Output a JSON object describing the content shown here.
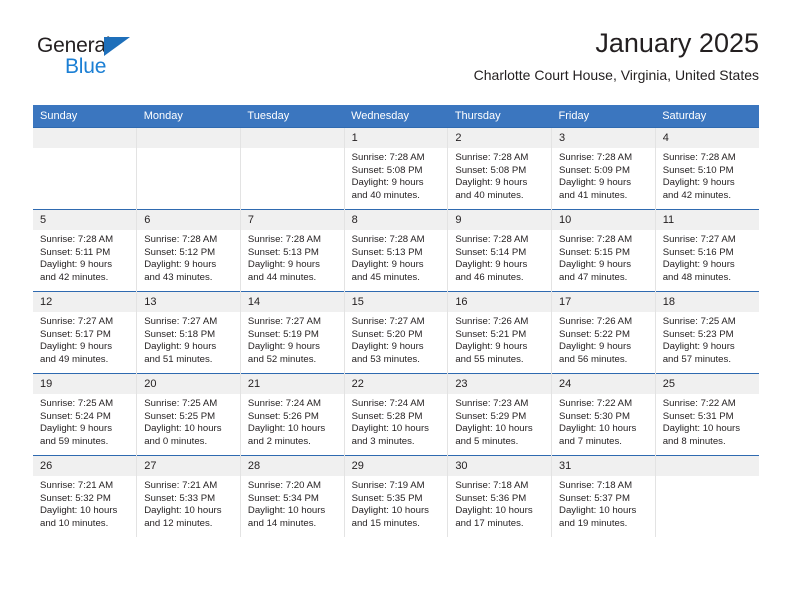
{
  "logo": {
    "word_primary": "General",
    "word_secondary": "Blue",
    "triangle_color": "#1e6fba",
    "secondary_color": "#1b7fd4"
  },
  "header": {
    "title": "January 2025",
    "subtitle": "Charlotte Court House, Virginia, United States"
  },
  "theme": {
    "header_blue": "#3b76bf",
    "row_rule_blue": "#2f6ab0",
    "daynum_band": "#f0f0f0"
  },
  "day_headers": [
    "Sunday",
    "Monday",
    "Tuesday",
    "Wednesday",
    "Thursday",
    "Friday",
    "Saturday"
  ],
  "weeks": [
    [
      {
        "day": "",
        "empty": true,
        "sunrise": "",
        "sunset": "",
        "daylight1": "",
        "daylight2": ""
      },
      {
        "day": "",
        "empty": true,
        "sunrise": "",
        "sunset": "",
        "daylight1": "",
        "daylight2": ""
      },
      {
        "day": "",
        "empty": true,
        "sunrise": "",
        "sunset": "",
        "daylight1": "",
        "daylight2": ""
      },
      {
        "day": "1",
        "sunrise": "Sunrise: 7:28 AM",
        "sunset": "Sunset: 5:08 PM",
        "daylight1": "Daylight: 9 hours",
        "daylight2": "and 40 minutes."
      },
      {
        "day": "2",
        "sunrise": "Sunrise: 7:28 AM",
        "sunset": "Sunset: 5:08 PM",
        "daylight1": "Daylight: 9 hours",
        "daylight2": "and 40 minutes."
      },
      {
        "day": "3",
        "sunrise": "Sunrise: 7:28 AM",
        "sunset": "Sunset: 5:09 PM",
        "daylight1": "Daylight: 9 hours",
        "daylight2": "and 41 minutes."
      },
      {
        "day": "4",
        "sunrise": "Sunrise: 7:28 AM",
        "sunset": "Sunset: 5:10 PM",
        "daylight1": "Daylight: 9 hours",
        "daylight2": "and 42 minutes."
      }
    ],
    [
      {
        "day": "5",
        "sunrise": "Sunrise: 7:28 AM",
        "sunset": "Sunset: 5:11 PM",
        "daylight1": "Daylight: 9 hours",
        "daylight2": "and 42 minutes."
      },
      {
        "day": "6",
        "sunrise": "Sunrise: 7:28 AM",
        "sunset": "Sunset: 5:12 PM",
        "daylight1": "Daylight: 9 hours",
        "daylight2": "and 43 minutes."
      },
      {
        "day": "7",
        "sunrise": "Sunrise: 7:28 AM",
        "sunset": "Sunset: 5:13 PM",
        "daylight1": "Daylight: 9 hours",
        "daylight2": "and 44 minutes."
      },
      {
        "day": "8",
        "sunrise": "Sunrise: 7:28 AM",
        "sunset": "Sunset: 5:13 PM",
        "daylight1": "Daylight: 9 hours",
        "daylight2": "and 45 minutes."
      },
      {
        "day": "9",
        "sunrise": "Sunrise: 7:28 AM",
        "sunset": "Sunset: 5:14 PM",
        "daylight1": "Daylight: 9 hours",
        "daylight2": "and 46 minutes."
      },
      {
        "day": "10",
        "sunrise": "Sunrise: 7:28 AM",
        "sunset": "Sunset: 5:15 PM",
        "daylight1": "Daylight: 9 hours",
        "daylight2": "and 47 minutes."
      },
      {
        "day": "11",
        "sunrise": "Sunrise: 7:27 AM",
        "sunset": "Sunset: 5:16 PM",
        "daylight1": "Daylight: 9 hours",
        "daylight2": "and 48 minutes."
      }
    ],
    [
      {
        "day": "12",
        "sunrise": "Sunrise: 7:27 AM",
        "sunset": "Sunset: 5:17 PM",
        "daylight1": "Daylight: 9 hours",
        "daylight2": "and 49 minutes."
      },
      {
        "day": "13",
        "sunrise": "Sunrise: 7:27 AM",
        "sunset": "Sunset: 5:18 PM",
        "daylight1": "Daylight: 9 hours",
        "daylight2": "and 51 minutes."
      },
      {
        "day": "14",
        "sunrise": "Sunrise: 7:27 AM",
        "sunset": "Sunset: 5:19 PM",
        "daylight1": "Daylight: 9 hours",
        "daylight2": "and 52 minutes."
      },
      {
        "day": "15",
        "sunrise": "Sunrise: 7:27 AM",
        "sunset": "Sunset: 5:20 PM",
        "daylight1": "Daylight: 9 hours",
        "daylight2": "and 53 minutes."
      },
      {
        "day": "16",
        "sunrise": "Sunrise: 7:26 AM",
        "sunset": "Sunset: 5:21 PM",
        "daylight1": "Daylight: 9 hours",
        "daylight2": "and 55 minutes."
      },
      {
        "day": "17",
        "sunrise": "Sunrise: 7:26 AM",
        "sunset": "Sunset: 5:22 PM",
        "daylight1": "Daylight: 9 hours",
        "daylight2": "and 56 minutes."
      },
      {
        "day": "18",
        "sunrise": "Sunrise: 7:25 AM",
        "sunset": "Sunset: 5:23 PM",
        "daylight1": "Daylight: 9 hours",
        "daylight2": "and 57 minutes."
      }
    ],
    [
      {
        "day": "19",
        "sunrise": "Sunrise: 7:25 AM",
        "sunset": "Sunset: 5:24 PM",
        "daylight1": "Daylight: 9 hours",
        "daylight2": "and 59 minutes."
      },
      {
        "day": "20",
        "sunrise": "Sunrise: 7:25 AM",
        "sunset": "Sunset: 5:25 PM",
        "daylight1": "Daylight: 10 hours",
        "daylight2": "and 0 minutes."
      },
      {
        "day": "21",
        "sunrise": "Sunrise: 7:24 AM",
        "sunset": "Sunset: 5:26 PM",
        "daylight1": "Daylight: 10 hours",
        "daylight2": "and 2 minutes."
      },
      {
        "day": "22",
        "sunrise": "Sunrise: 7:24 AM",
        "sunset": "Sunset: 5:28 PM",
        "daylight1": "Daylight: 10 hours",
        "daylight2": "and 3 minutes."
      },
      {
        "day": "23",
        "sunrise": "Sunrise: 7:23 AM",
        "sunset": "Sunset: 5:29 PM",
        "daylight1": "Daylight: 10 hours",
        "daylight2": "and 5 minutes."
      },
      {
        "day": "24",
        "sunrise": "Sunrise: 7:22 AM",
        "sunset": "Sunset: 5:30 PM",
        "daylight1": "Daylight: 10 hours",
        "daylight2": "and 7 minutes."
      },
      {
        "day": "25",
        "sunrise": "Sunrise: 7:22 AM",
        "sunset": "Sunset: 5:31 PM",
        "daylight1": "Daylight: 10 hours",
        "daylight2": "and 8 minutes."
      }
    ],
    [
      {
        "day": "26",
        "sunrise": "Sunrise: 7:21 AM",
        "sunset": "Sunset: 5:32 PM",
        "daylight1": "Daylight: 10 hours",
        "daylight2": "and 10 minutes."
      },
      {
        "day": "27",
        "sunrise": "Sunrise: 7:21 AM",
        "sunset": "Sunset: 5:33 PM",
        "daylight1": "Daylight: 10 hours",
        "daylight2": "and 12 minutes."
      },
      {
        "day": "28",
        "sunrise": "Sunrise: 7:20 AM",
        "sunset": "Sunset: 5:34 PM",
        "daylight1": "Daylight: 10 hours",
        "daylight2": "and 14 minutes."
      },
      {
        "day": "29",
        "sunrise": "Sunrise: 7:19 AM",
        "sunset": "Sunset: 5:35 PM",
        "daylight1": "Daylight: 10 hours",
        "daylight2": "and 15 minutes."
      },
      {
        "day": "30",
        "sunrise": "Sunrise: 7:18 AM",
        "sunset": "Sunset: 5:36 PM",
        "daylight1": "Daylight: 10 hours",
        "daylight2": "and 17 minutes."
      },
      {
        "day": "31",
        "sunrise": "Sunrise: 7:18 AM",
        "sunset": "Sunset: 5:37 PM",
        "daylight1": "Daylight: 10 hours",
        "daylight2": "and 19 minutes."
      },
      {
        "day": "",
        "empty": true,
        "sunrise": "",
        "sunset": "",
        "daylight1": "",
        "daylight2": ""
      }
    ]
  ]
}
